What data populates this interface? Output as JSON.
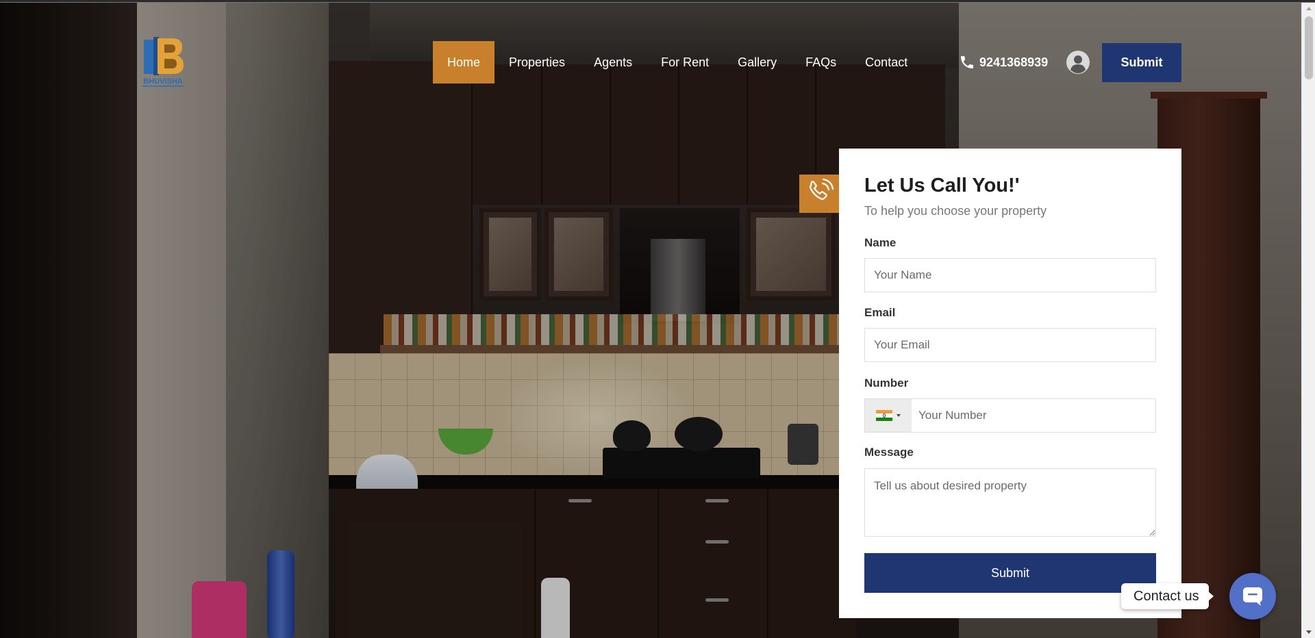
{
  "brand": {
    "logo_text": "BHUVISHA"
  },
  "nav": {
    "items": [
      {
        "label": "Home"
      },
      {
        "label": "Properties"
      },
      {
        "label": "Agents"
      },
      {
        "label": "For Rent"
      },
      {
        "label": "Gallery"
      },
      {
        "label": "FAQs"
      },
      {
        "label": "Contact"
      }
    ],
    "active_index": 0,
    "phone": "9241368939",
    "submit_label": "Submit"
  },
  "form": {
    "title": "Let Us Call You!'",
    "subtitle": "To help you choose your property",
    "name_label": "Name",
    "name_placeholder": "Your Name",
    "email_label": "Email",
    "email_placeholder": "Your Email",
    "number_label": "Number",
    "number_placeholder": "Your Number",
    "message_label": "Message",
    "message_placeholder": "Tell us about desired property",
    "submit_label": "Submit"
  },
  "contact_widget": {
    "label": "Contact us"
  },
  "colors": {
    "accent": "#c9802c",
    "primary": "#1f3673",
    "widget": "#5370c9"
  },
  "icons": {
    "phone": "phone-icon",
    "user": "user-circle-icon",
    "call_tab": "phone-ringing-icon",
    "chat": "chat-icon",
    "flag": "india-flag-icon"
  }
}
